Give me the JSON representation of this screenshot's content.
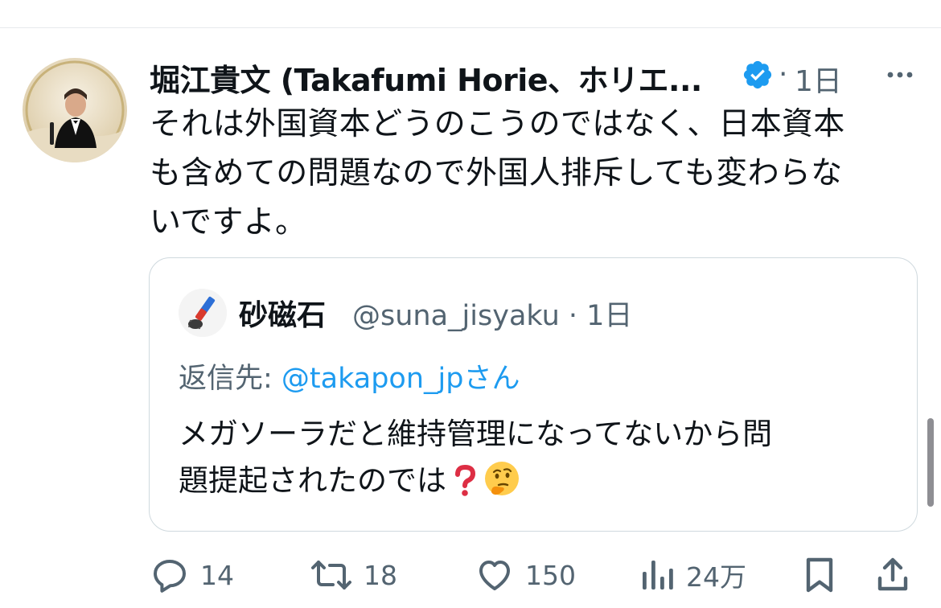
{
  "tweet": {
    "author_name": "堀江貴文 (Takafumi Horie、ホリエ...",
    "verified": true,
    "separator": "·",
    "time_ago": "1日",
    "text_lines": [
      "それは外国資本どうのこうのではなく、日本資本",
      "も含めての問題なので外国人排斥しても変わらな",
      "いですよ。"
    ]
  },
  "quote": {
    "author_name": "砂磁石",
    "handle_time": "@suna_jisyaku · 1日",
    "reply_prefix": "返信先: ",
    "reply_mention": "@takapon_jp",
    "reply_suffix": "さん",
    "text_lines": [
      "メガソーラだと維持管理になってないから問",
      "題提起されたのでは"
    ],
    "emojis": [
      "❓",
      "🤔"
    ]
  },
  "actions": {
    "replies": "14",
    "retweets": "18",
    "likes": "150",
    "views": "24万"
  },
  "icons": {
    "verified": "verified-badge-icon",
    "more": "more-options-icon",
    "reply": "reply-icon",
    "retweet": "retweet-icon",
    "like": "heart-icon",
    "views": "views-chart-icon",
    "bookmark": "bookmark-icon",
    "share": "share-icon"
  },
  "colors": {
    "text": "#0f1419",
    "secondary": "#536471",
    "accent": "#1d9bf0",
    "border": "#cfd9de"
  }
}
